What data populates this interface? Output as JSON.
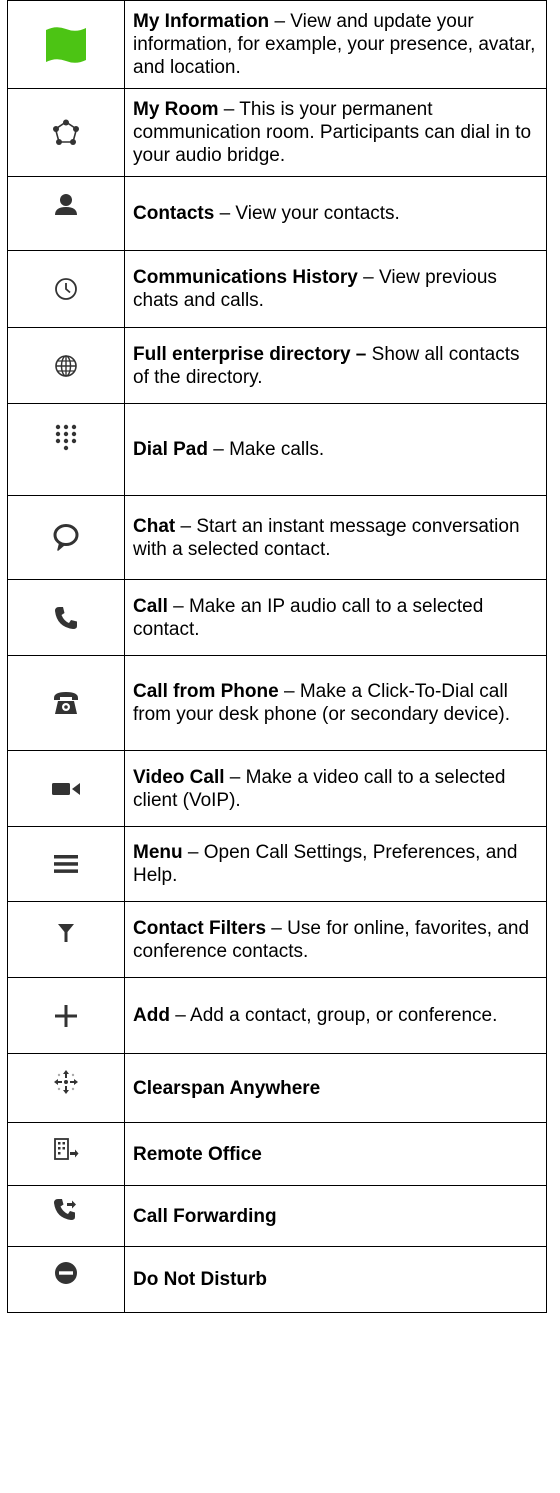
{
  "rows": [
    {
      "icon": "my-information-flag-icon",
      "title": "My Information",
      "sep": " – ",
      "desc": "View and update your information, for example, your presence, avatar, and location."
    },
    {
      "icon": "my-room-icon",
      "title": "My Room",
      "sep": " – ",
      "desc": "This is your permanent communication room.  Participants can dial in to your audio bridge."
    },
    {
      "icon": "contacts-person-icon",
      "title": "Contacts",
      "sep": " – ",
      "desc": "View your contacts."
    },
    {
      "icon": "clock-history-icon",
      "title": "Communications History",
      "sep": " – ",
      "desc": "View previous chats and calls."
    },
    {
      "icon": "globe-icon",
      "title": "Full enterprise directory –",
      "sep": " ",
      "desc": "Show all contacts of the directory."
    },
    {
      "icon": "dial-pad-icon",
      "title": "Dial Pad",
      "sep": " – ",
      "desc": "Make calls."
    },
    {
      "icon": "chat-bubble-icon",
      "title": "Chat",
      "sep": " – ",
      "desc": "Start an instant message conversation with a selected contact."
    },
    {
      "icon": "phone-handset-icon",
      "title": "Call",
      "sep": " – ",
      "desc": "Make an IP audio call to a selected contact."
    },
    {
      "icon": "desk-phone-icon",
      "title": "Call from Phone",
      "sep": " – ",
      "desc": "Make a Click-To-Dial call from your desk phone (or secondary device)."
    },
    {
      "icon": "video-camera-icon",
      "title": "Video Call",
      "sep": " – ",
      "desc": "Make a video call to a selected client (VoIP)."
    },
    {
      "icon": "hamburger-menu-icon",
      "title": "Menu",
      "sep": " – ",
      "desc": "Open Call Settings, Preferences, and Help."
    },
    {
      "icon": "filter-funnel-icon",
      "title": "Contact Filters",
      "sep": " – ",
      "desc": "Use for online, favorites, and conference contacts."
    },
    {
      "icon": "plus-icon",
      "title": "Add",
      "sep": " – ",
      "desc": "Add a contact, group, or conference."
    },
    {
      "icon": "clearspan-anywhere-icon",
      "title": "Clearspan Anywhere",
      "sep": "",
      "desc": ""
    },
    {
      "icon": "remote-office-icon",
      "title": "Remote Office",
      "sep": "",
      "desc": ""
    },
    {
      "icon": "call-forwarding-icon",
      "title": "Call Forwarding",
      "sep": "",
      "desc": ""
    },
    {
      "icon": "do-not-disturb-icon",
      "title": "Do Not Disturb",
      "sep": "",
      "desc": ""
    }
  ],
  "colors": {
    "flag": "#4cc414",
    "icon": "#333333"
  }
}
